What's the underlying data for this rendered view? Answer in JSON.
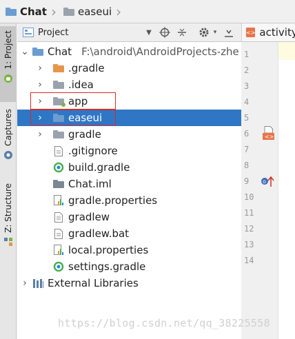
{
  "breadcrumb": {
    "items": [
      {
        "label": "Chat",
        "icon": "folder-icon"
      },
      {
        "label": "easeui",
        "icon": "folder-icon"
      }
    ]
  },
  "toolstrip": {
    "tabs": [
      {
        "label": "1: Project",
        "icon": "android-icon",
        "active": true
      },
      {
        "label": "Captures",
        "icon": "capture-icon",
        "active": false
      },
      {
        "label": "Z: Structure",
        "icon": "structure-icon",
        "active": false
      }
    ]
  },
  "panel": {
    "title": "Project",
    "view_dropdown_arrow": "▼",
    "buttons": [
      "locate-icon",
      "collapse-icon",
      "gear-icon",
      "hide-icon"
    ]
  },
  "tree": {
    "root": {
      "label": "Chat",
      "path": "F:\\android\\AndroidProjects-zhe"
    },
    "items": [
      {
        "label": ".gradle",
        "icon": "folder-orange",
        "expandable": true
      },
      {
        "label": ".idea",
        "icon": "folder-gray",
        "expandable": true
      },
      {
        "label": "app",
        "icon": "module-folder",
        "expandable": true,
        "highlighted": true
      },
      {
        "label": "easeui",
        "icon": "module-folder",
        "expandable": true,
        "selected": true,
        "highlighted": true
      },
      {
        "label": "gradle",
        "icon": "folder-gray",
        "expandable": true
      },
      {
        "label": ".gitignore",
        "icon": "text-file"
      },
      {
        "label": "build.gradle",
        "icon": "gradle-file"
      },
      {
        "label": "Chat.iml",
        "icon": "iml-file"
      },
      {
        "label": "gradle.properties",
        "icon": "properties-file"
      },
      {
        "label": "gradlew",
        "icon": "text-file"
      },
      {
        "label": "gradlew.bat",
        "icon": "text-file"
      },
      {
        "label": "local.properties",
        "icon": "properties-file"
      },
      {
        "label": "settings.gradle",
        "icon": "gradle-file"
      }
    ],
    "external": {
      "label": "External Libraries",
      "icon": "library-icon"
    }
  },
  "editor": {
    "tab_label": "activity",
    "tab_icon": "xml-icon",
    "line_numbers": [
      "1",
      "2",
      "3",
      "4",
      "5",
      "6",
      "7",
      "8",
      "9",
      "10",
      "11",
      "12",
      "13",
      "14"
    ]
  },
  "watermark": "https://blog.csdn.net/qq_38225558",
  "colors": {
    "selection": "#2f76c5",
    "highlight_box": "#d62a2a",
    "orange_folder": "#e8954b"
  }
}
